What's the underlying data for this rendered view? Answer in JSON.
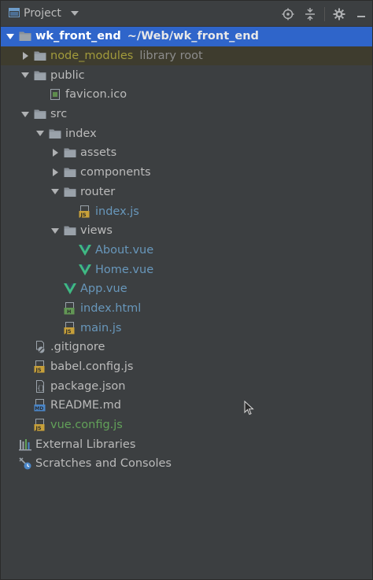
{
  "header": {
    "title": "Project",
    "icons": [
      "project-view-icon",
      "locate-icon",
      "collapse-all-icon",
      "settings-icon",
      "hide-icon"
    ]
  },
  "tree": [
    {
      "name": "wk_front_end",
      "extra": "~/Web/wk_front_end",
      "type": "folder",
      "state": "expanded",
      "selected": true
    },
    {
      "name": "node_modules",
      "extra": "library root",
      "type": "folder",
      "state": "collapsed",
      "excluded": true
    },
    {
      "name": "public",
      "type": "folder",
      "state": "expanded"
    },
    {
      "name": "favicon.ico",
      "type": "ico-file"
    },
    {
      "name": "src",
      "type": "folder",
      "state": "expanded"
    },
    {
      "name": "index",
      "type": "folder",
      "state": "expanded"
    },
    {
      "name": "assets",
      "type": "folder",
      "state": "collapsed"
    },
    {
      "name": "components",
      "type": "folder",
      "state": "collapsed"
    },
    {
      "name": "router",
      "type": "folder",
      "state": "expanded"
    },
    {
      "name": "index.js",
      "type": "js-file"
    },
    {
      "name": "views",
      "type": "folder",
      "state": "expanded"
    },
    {
      "name": "About.vue",
      "type": "vue-file"
    },
    {
      "name": "Home.vue",
      "type": "vue-file"
    },
    {
      "name": "App.vue",
      "type": "vue-file"
    },
    {
      "name": "index.html",
      "type": "html-file"
    },
    {
      "name": "main.js",
      "type": "js-file"
    },
    {
      "name": ".gitignore",
      "type": "gitignore-file"
    },
    {
      "name": "babel.config.js",
      "type": "js-file"
    },
    {
      "name": "package.json",
      "type": "json-file"
    },
    {
      "name": "README.md",
      "type": "md-file"
    },
    {
      "name": "vue.config.js",
      "type": "js-file"
    },
    {
      "name": "External Libraries",
      "type": "libraries"
    },
    {
      "name": "Scratches and Consoles",
      "type": "scratches"
    }
  ],
  "colors": {
    "selection": "#2f65ca",
    "folder": "#8a9199",
    "vue": "#3fb983",
    "js_badge": "#c7a03a"
  }
}
